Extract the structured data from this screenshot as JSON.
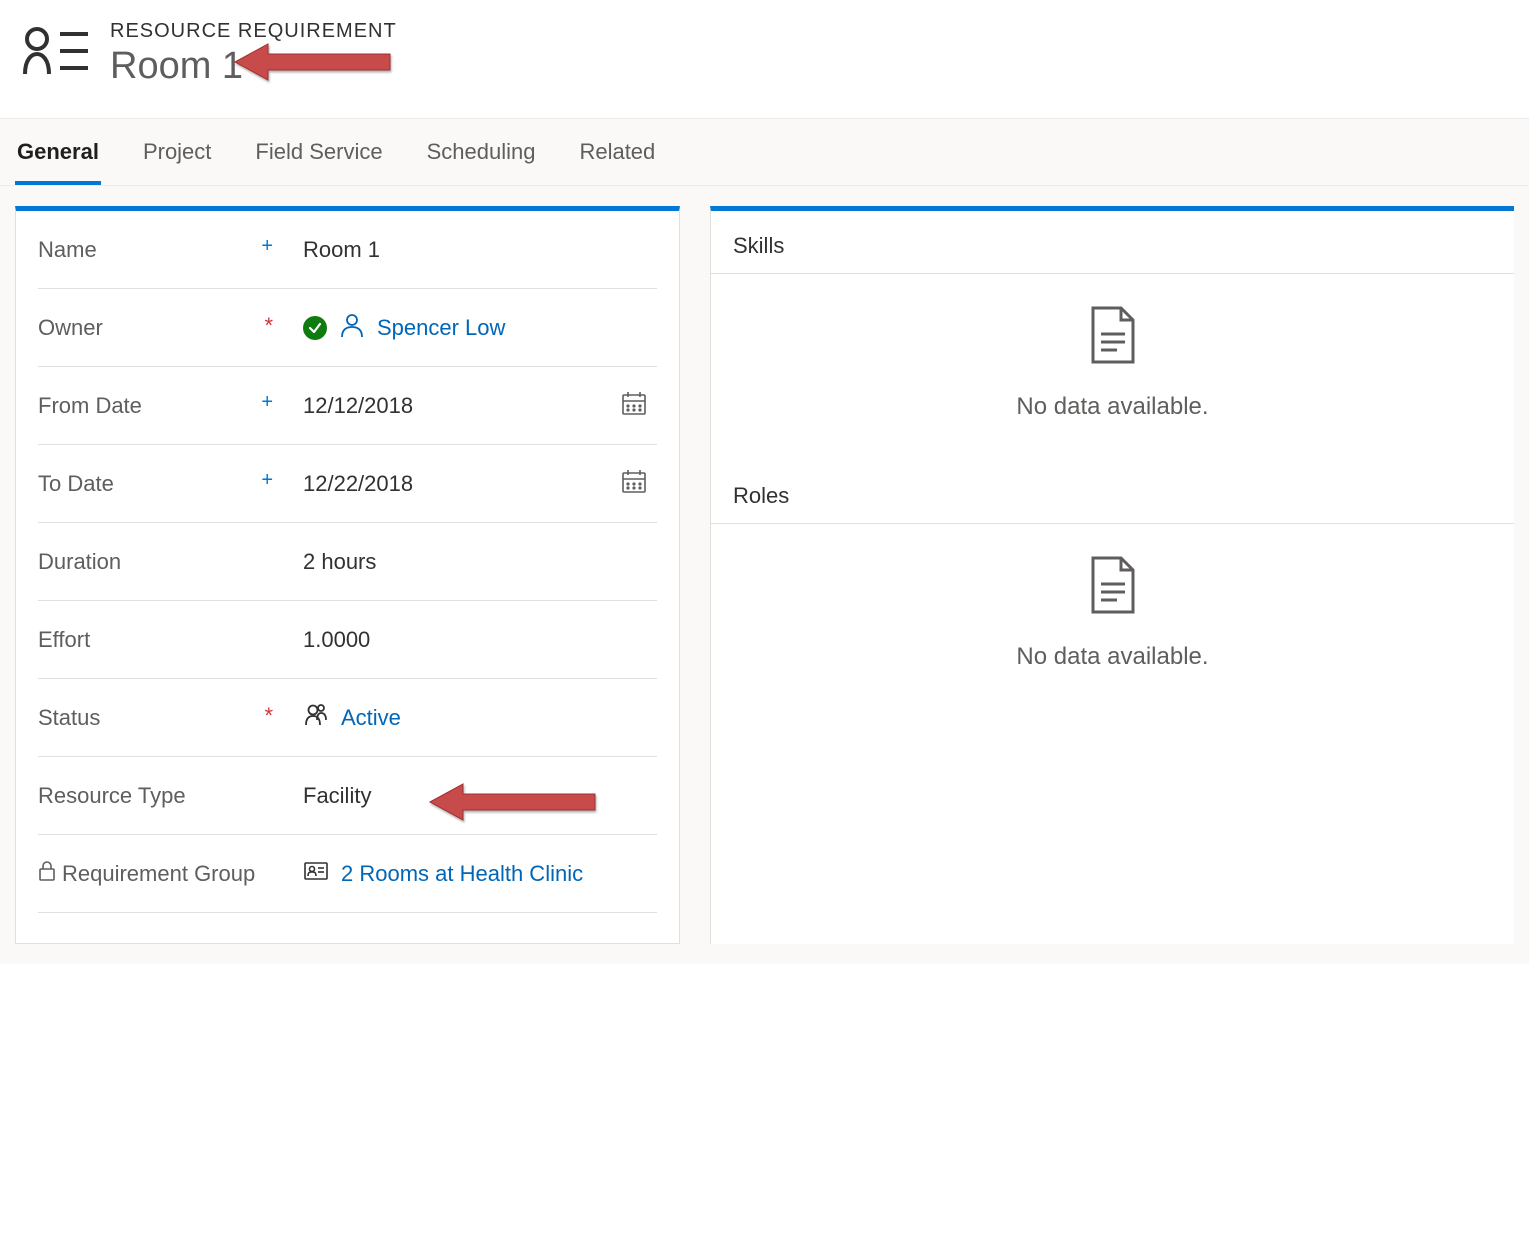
{
  "header": {
    "subtitle": "RESOURCE REQUIREMENT",
    "title": "Room 1"
  },
  "tabs": [
    {
      "label": "General",
      "active": true
    },
    {
      "label": "Project",
      "active": false
    },
    {
      "label": "Field Service",
      "active": false
    },
    {
      "label": "Scheduling",
      "active": false
    },
    {
      "label": "Related",
      "active": false
    }
  ],
  "fields": {
    "name": {
      "label": "Name",
      "value": "Room 1"
    },
    "owner": {
      "label": "Owner",
      "value": "Spencer Low"
    },
    "from_date": {
      "label": "From Date",
      "value": "12/12/2018"
    },
    "to_date": {
      "label": "To Date",
      "value": "12/22/2018"
    },
    "duration": {
      "label": "Duration",
      "value": "2 hours"
    },
    "effort": {
      "label": "Effort",
      "value": "1.0000"
    },
    "status": {
      "label": "Status",
      "value": "Active"
    },
    "resource_type": {
      "label": "Resource Type",
      "value": "Facility"
    },
    "requirement_group": {
      "label": "Requirement Group",
      "value": "2 Rooms at Health Clinic"
    }
  },
  "right": {
    "skills": {
      "title": "Skills",
      "empty": "No data available."
    },
    "roles": {
      "title": "Roles",
      "empty": "No data available."
    }
  }
}
